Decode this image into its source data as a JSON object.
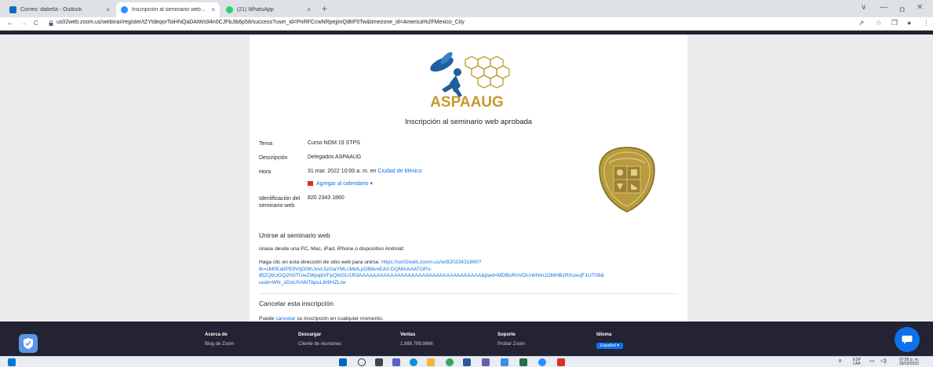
{
  "browser": {
    "tabs": [
      {
        "title": "Correo: dabella - Outlook",
        "close": "×"
      },
      {
        "title": "Inscripción al seminario web estr...",
        "close": "×"
      },
      {
        "title": "(21) WhatsApp",
        "close": "×"
      }
    ],
    "new_tab": "+",
    "url": "us02web.zoom.us/webinar/register/tZYtdeqorToiHNQaDAtWs94n0CJFbJib6p58/success?user_id=PnRFCcwNRpejjmQiBIF5Tw&timezone_id=America%2FMexico_City",
    "nav": {
      "back": "←",
      "forward": "→",
      "reload": "C"
    },
    "window_controls": {
      "down": "∨",
      "minimize": "—",
      "restore": "ㅁ",
      "close": "✕"
    },
    "tools": {
      "share": "⇗",
      "star": "☆",
      "sidebar": "❐",
      "profile": "●",
      "menu": "⋮"
    }
  },
  "page": {
    "logo_text": "ASPAAUG",
    "heading": "Inscripción al seminario web aprobada",
    "details": {
      "topic_label": "Tema",
      "topic_value": "Curso NOM 19 STPS",
      "description_label": "Descripción",
      "description_value": "Delegados ASPAAUG",
      "time_label": "Hora",
      "time_value": "31 mar. 2022 10:00 a. m. en",
      "time_zone_link": "Ciudad de México",
      "add_calendar": "Agregar al calendario ▾",
      "webinar_id_label": "Identificación del seminario web",
      "webinar_id_value": "820 2343 1860"
    },
    "join": {
      "heading": "Unirse al seminario web",
      "devices_text": "únase desde una PC, Mac, iPad, iPhone o dispositivo Android:",
      "click_text": "Haga clic en esta dirección de sitio web para unirse.",
      "join_url_1": "https://us02web.zoom.us/w/82023431860?",
      "join_url_2": "tk=sM0EatIPE9VIjG0thJvvL5zGaYMLcMelLpOBitvxEA0.DQMAAAATGPo-",
      "join_url_3": "tBZQbUGQ2N3TUwZWpqbVFpQkIGU1R3AAAAAAAAAAAAAAAAAAAAAAAAAAAAAAAAAAA&pwd=MDBoRnVOUnlrNm1DMHBzRXoxcjF1UT09&",
      "join_url_4": "uuid=WN_sDnUXA6iTbpuL6r6HZLrw"
    },
    "cancel": {
      "heading": "Cancelar esta inscripción",
      "pre": "Puede",
      "link": "cancelar",
      "post": "su inscripción en cualquier momento."
    }
  },
  "footer": {
    "cols": [
      {
        "heading": "Acerca de",
        "item": "Blog de Zoom"
      },
      {
        "heading": "Descargar",
        "item": "Cliente de reuniones"
      },
      {
        "heading": "Ventas",
        "item": "1.888.799.9666"
      },
      {
        "heading": "Soporte",
        "item": "Probar Zoom"
      },
      {
        "heading": "Idioma",
        "item": "Español ▾"
      }
    ]
  },
  "taskbar": {
    "lang_1": "ESP",
    "lang_2": "LAA",
    "time": "07:56 p. m.",
    "date": "28/03/2022",
    "chevron": "∧"
  },
  "colors": {
    "zoom_blue": "#0e71eb",
    "zoom_dark": "#232333",
    "aspaaug_blue": "#1f5f9e",
    "aspaaug_gold": "#c49a2c"
  }
}
